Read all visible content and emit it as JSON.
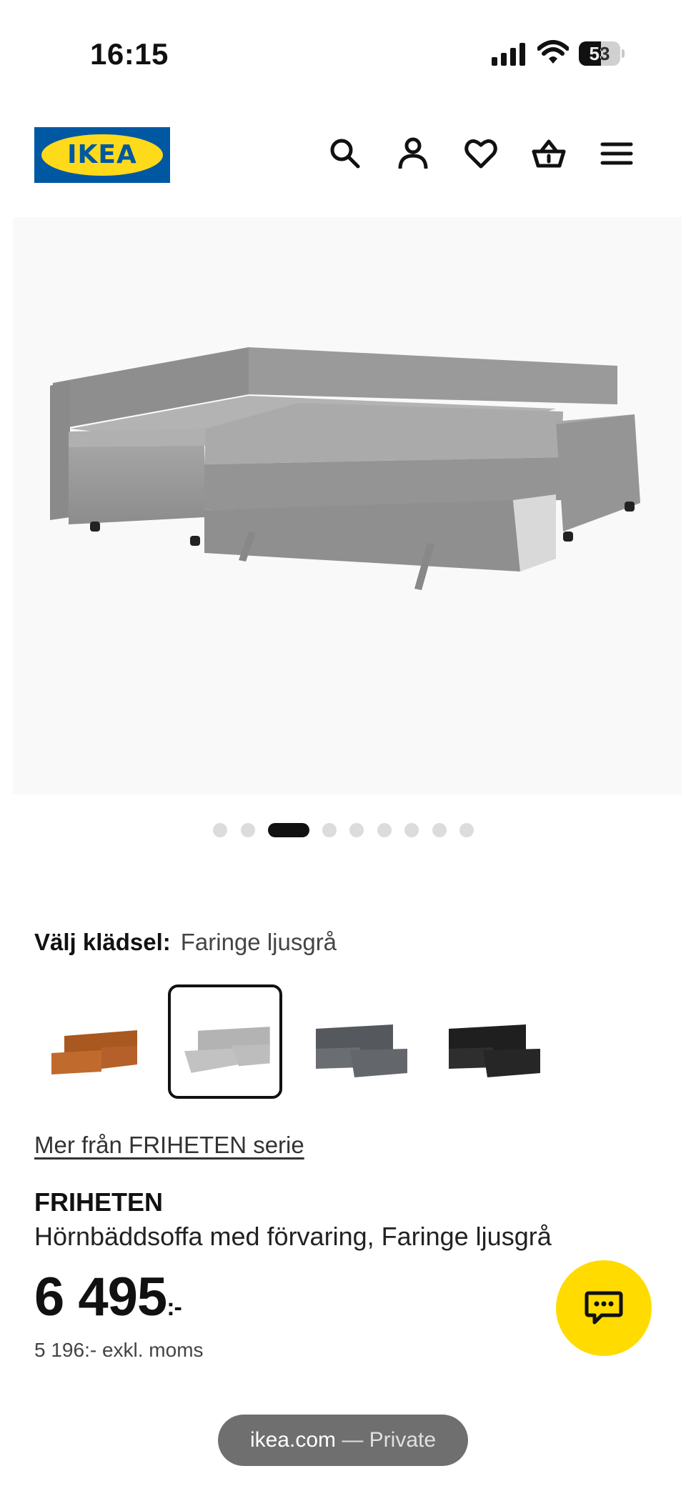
{
  "status_bar": {
    "time": "16:15",
    "battery_level": "53",
    "icons": [
      "signal-icon",
      "wifi-icon",
      "battery-icon"
    ]
  },
  "header": {
    "logo_text": "IKEA",
    "brand_colors": {
      "blue": "#0058a3",
      "yellow": "#ffda1a"
    },
    "icons": [
      "search-icon",
      "account-icon",
      "heart-icon",
      "cart-icon",
      "menu-icon"
    ]
  },
  "gallery": {
    "image_alt": "FRIHETEN corner sofa-bed, grey",
    "image_count": 9,
    "active_index": 3
  },
  "options": {
    "label": "Välj klädsel:",
    "selected_value": "Faringe ljusgrå",
    "swatches": [
      {
        "name": "brown",
        "color": "#b9652c"
      },
      {
        "name": "light-grey",
        "color": "#b9b9b9",
        "selected": true
      },
      {
        "name": "dark-grey",
        "color": "#5f6166"
      },
      {
        "name": "black",
        "color": "#2a2a2a"
      }
    ]
  },
  "series_link": "Mer från FRIHETEN serie",
  "product": {
    "name": "FRIHETEN",
    "description": "Hörnbäddsoffa med förvaring, Faringe ljusgrå",
    "price": "6 495",
    "price_suffix": ":-",
    "price_excl_vat": "5 196:- exkl. moms"
  },
  "chat": {
    "icon": "chat-icon",
    "color": "#ffdb00"
  },
  "browser": {
    "domain": "ikea.com",
    "separator": " — ",
    "mode": "Private"
  }
}
